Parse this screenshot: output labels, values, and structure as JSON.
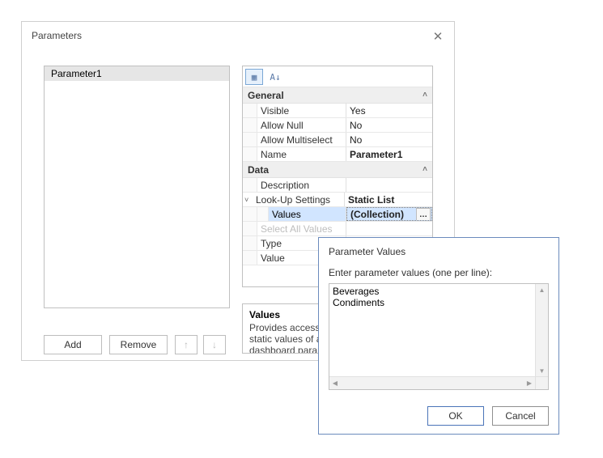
{
  "dialog": {
    "title": "Parameters",
    "list": {
      "items": [
        "Parameter1"
      ],
      "selected_index": 0
    },
    "buttons": {
      "add": "Add",
      "remove": "Remove"
    }
  },
  "propgrid": {
    "categories": [
      {
        "name": "General",
        "rows": [
          {
            "label": "Visible",
            "value": "Yes"
          },
          {
            "label": "Allow Null",
            "value": "No"
          },
          {
            "label": "Allow Multiselect",
            "value": "No"
          },
          {
            "label": "Name",
            "value": "Parameter1",
            "bold": true
          }
        ]
      },
      {
        "name": "Data",
        "rows": [
          {
            "label": "Description",
            "value": ""
          },
          {
            "label": "Look-Up Settings",
            "value": "Static List",
            "bold": true,
            "expandable": true,
            "expanded": true
          },
          {
            "label": "Values",
            "value": "(Collection)",
            "deep": true,
            "selected": true,
            "ellipsis": true
          },
          {
            "label": "Select All Values",
            "value": "",
            "disabled": true
          },
          {
            "label": "Type",
            "value": ""
          },
          {
            "label": "Value",
            "value": ""
          }
        ]
      }
    ],
    "description": {
      "title": "Values",
      "body_line1": "Provides access to the collection of static values of a",
      "body_line2": "dashboard parameter."
    }
  },
  "popup": {
    "title": "Parameter Values",
    "prompt": "Enter parameter values (one per line):",
    "text": "Beverages\nCondiments",
    "ok": "OK",
    "cancel": "Cancel"
  }
}
